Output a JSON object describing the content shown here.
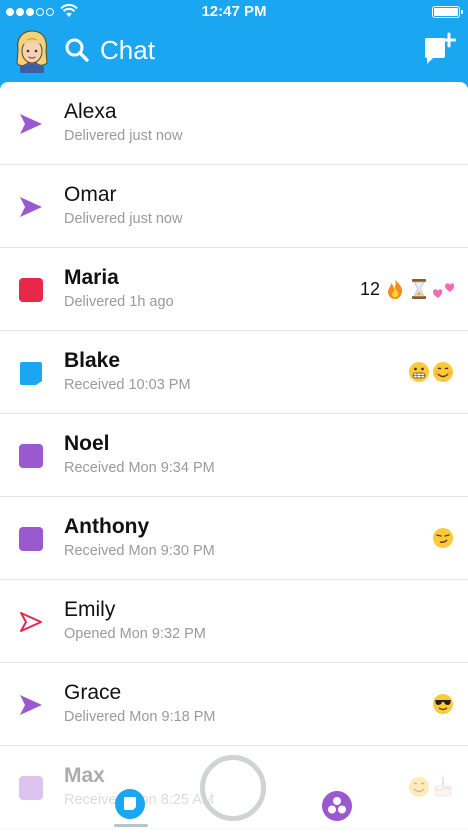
{
  "status": {
    "time": "12:47 PM"
  },
  "header": {
    "title": "Chat"
  },
  "chats": [
    {
      "name": "Alexa",
      "status": "Delivered just now",
      "icon": "sent-arrow-purple-icon",
      "bold": false,
      "streak": "",
      "emoji": []
    },
    {
      "name": "Omar",
      "status": "Delivered just now",
      "icon": "sent-arrow-purple-icon",
      "bold": false,
      "streak": "",
      "emoji": []
    },
    {
      "name": "Maria",
      "status": "Delivered 1h ago",
      "icon": "red-square-icon",
      "bold": true,
      "streak": "12",
      "emoji": [
        "fire-emoji",
        "hourglass-emoji",
        "pink-hearts-emoji"
      ]
    },
    {
      "name": "Blake",
      "status": "Received 10:03 PM",
      "icon": "blue-chat-bubble-icon",
      "bold": true,
      "streak": "",
      "emoji": [
        "grimacing-emoji",
        "smiling-emoji"
      ]
    },
    {
      "name": "Noel",
      "status": "Received Mon 9:34 PM",
      "icon": "purple-square-icon",
      "bold": true,
      "streak": "",
      "emoji": []
    },
    {
      "name": "Anthony",
      "status": "Received Mon 9:30 PM",
      "icon": "purple-square-icon",
      "bold": true,
      "streak": "",
      "emoji": [
        "smirking-emoji"
      ]
    },
    {
      "name": "Emily",
      "status": "Opened Mon 9:32 PM",
      "icon": "opened-arrow-red-icon",
      "bold": false,
      "streak": "",
      "emoji": []
    },
    {
      "name": "Grace",
      "status": "Delivered Mon 9:18 PM",
      "icon": "sent-arrow-purple-icon",
      "bold": false,
      "streak": "",
      "emoji": [
        "sunglasses-emoji"
      ]
    },
    {
      "name": "Max",
      "status": "Received Mon 8:25 AM",
      "icon": "purple-square-icon",
      "bold": true,
      "streak": "",
      "emoji": [
        "smiling-emoji",
        "birthday-cake-emoji"
      ]
    }
  ]
}
